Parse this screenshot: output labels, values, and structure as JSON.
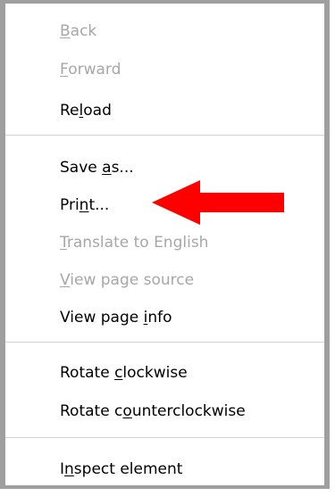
{
  "context_menu": {
    "items": [
      {
        "id": "back",
        "before": "",
        "mnemonic": "B",
        "after": "ack",
        "enabled": false
      },
      {
        "id": "forward",
        "before": "",
        "mnemonic": "F",
        "after": "orward",
        "enabled": false
      },
      {
        "id": "reload",
        "before": "Re",
        "mnemonic": "l",
        "after": "oad",
        "enabled": true
      },
      {
        "id": "save-as",
        "before": "Save ",
        "mnemonic": "a",
        "after": "s...",
        "enabled": true
      },
      {
        "id": "print",
        "before": "Pri",
        "mnemonic": "n",
        "after": "t...",
        "enabled": true
      },
      {
        "id": "translate",
        "before": "",
        "mnemonic": "T",
        "after": "ranslate to English",
        "enabled": false
      },
      {
        "id": "view-source",
        "before": "",
        "mnemonic": "V",
        "after": "iew page source",
        "enabled": false
      },
      {
        "id": "view-info",
        "before": "View page ",
        "mnemonic": "i",
        "after": "nfo",
        "enabled": true
      },
      {
        "id": "rotate-cw",
        "before": "Rotate ",
        "mnemonic": "c",
        "after": "lockwise",
        "enabled": true
      },
      {
        "id": "rotate-ccw",
        "before": "Rotate c",
        "mnemonic": "o",
        "after": "unterclockwise",
        "enabled": true
      },
      {
        "id": "inspect",
        "before": "I",
        "mnemonic": "n",
        "after": "spect element",
        "enabled": true
      }
    ]
  },
  "colors": {
    "arrow": "#ff0000",
    "disabled_text": "#a7a7a7",
    "enabled_text": "#000000",
    "border": "#9f9f9f",
    "divider": "#d3d3d3"
  },
  "annotation": {
    "icon": "red-arrow-icon",
    "points_to": "print"
  }
}
